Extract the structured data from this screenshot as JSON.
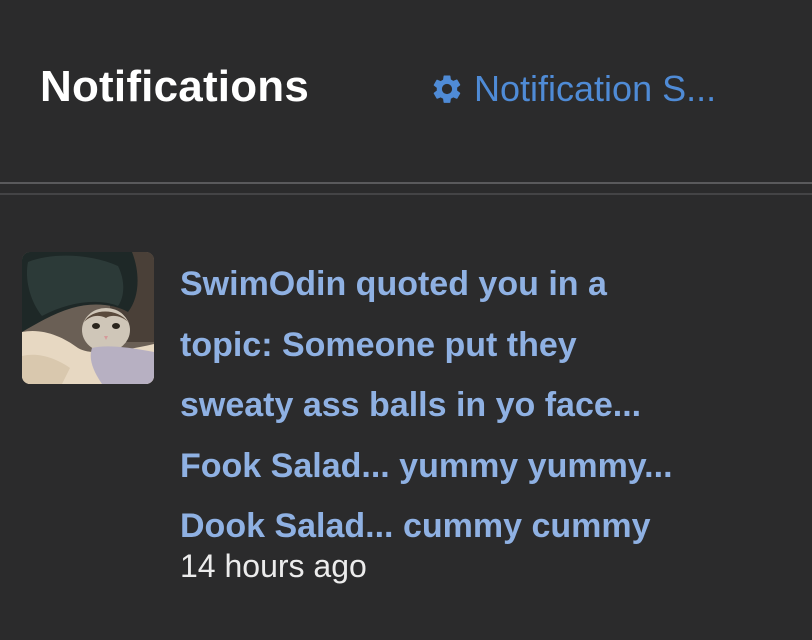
{
  "header": {
    "title": "Notifications",
    "settings_link_label": "Notification S...",
    "settings_icon": "gear-icon"
  },
  "notifications": [
    {
      "avatar": "cat-avatar",
      "text_lines": [
        "SwimOdin quoted you in a",
        "topic: Someone put they",
        "sweaty ass balls in yo face...",
        "Fook Salad... yummy yummy...",
        "Dook Salad... cummy cummy"
      ],
      "time": "14 hours ago"
    }
  ],
  "colors": {
    "background": "#2b2b2c",
    "title": "#ffffff",
    "link": "#4f8bd6",
    "notification_text": "#8fb1e3",
    "timestamp": "#ececec"
  }
}
